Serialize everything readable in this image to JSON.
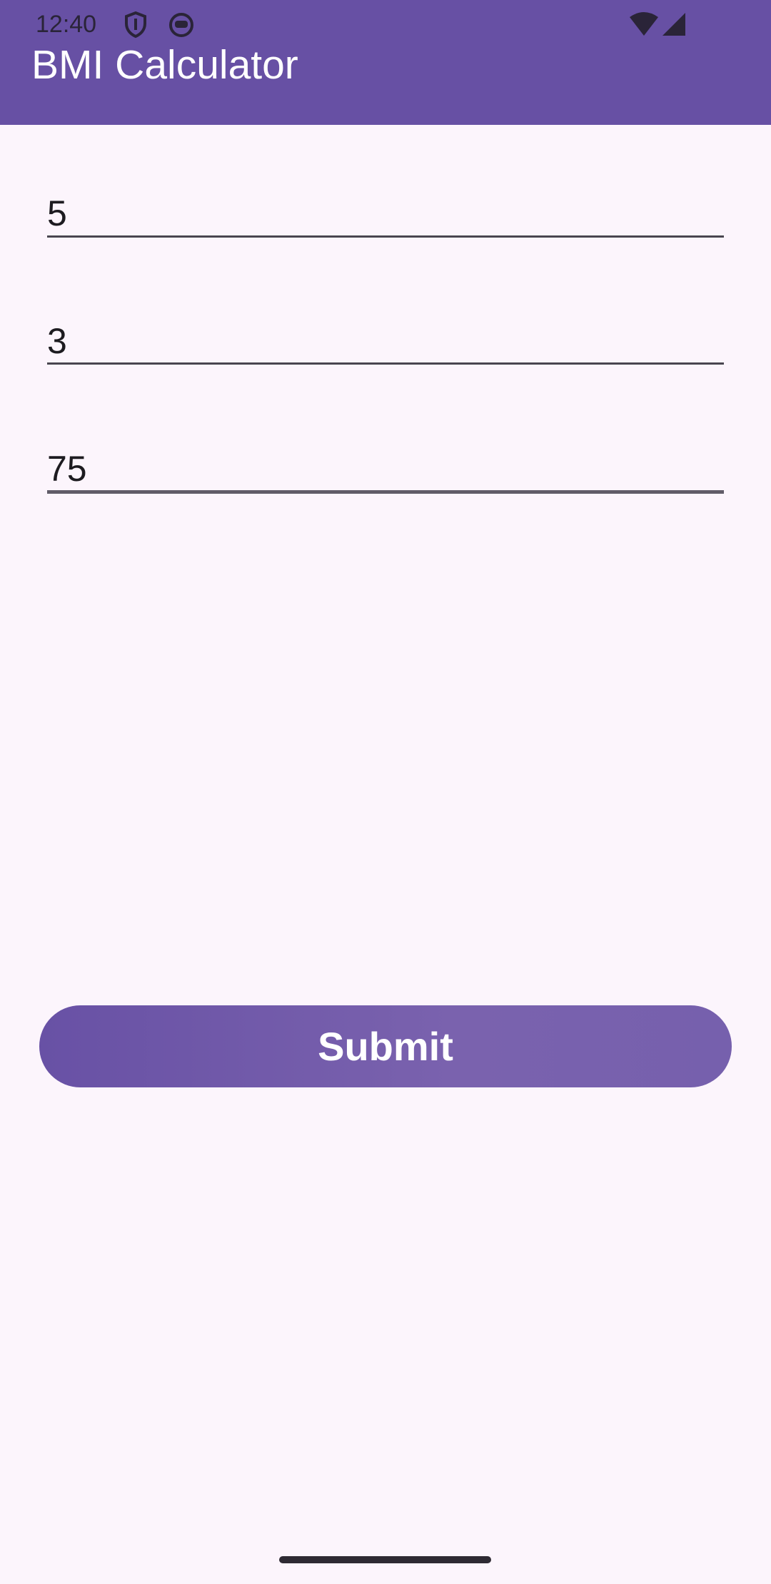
{
  "status_bar": {
    "time": "12:40",
    "icons": [
      "shield-icon",
      "robot-face-icon",
      "wifi-icon",
      "cell-signal-icon"
    ]
  },
  "app_bar": {
    "title": "BMI Calculator",
    "background_color": "#6750A4"
  },
  "form": {
    "fields": [
      {
        "value": "5",
        "placeholder": ""
      },
      {
        "value": "3",
        "placeholder": ""
      },
      {
        "value": "75",
        "placeholder": ""
      }
    ],
    "submit_label": "Submit"
  },
  "colors": {
    "page_background": "#FCF5FC",
    "accent": "#6750A4",
    "text": "#1D1B20"
  }
}
